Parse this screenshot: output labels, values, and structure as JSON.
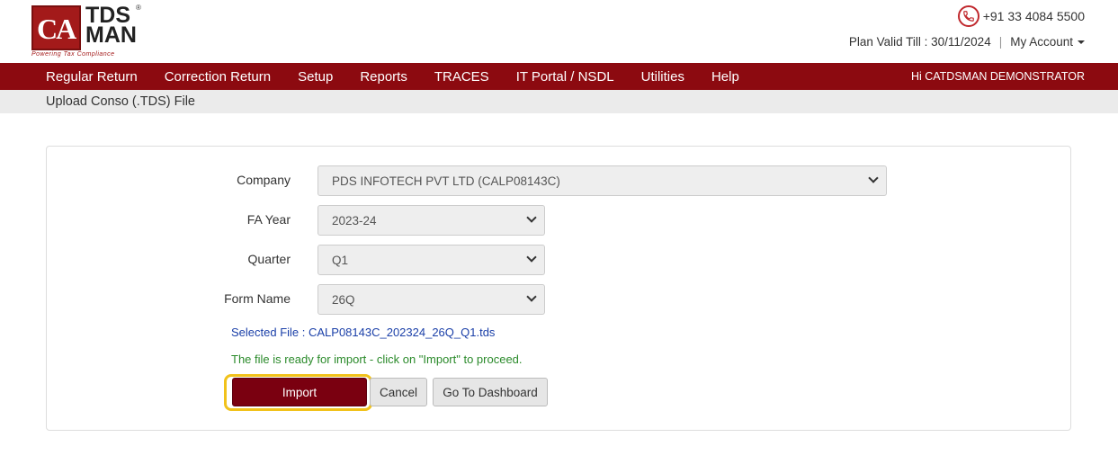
{
  "brand": {
    "logo_mark": "CA",
    "logo_line1": "TDS",
    "logo_line2": "MAN",
    "registered": "®",
    "tagline": "Powering Tax Compliance"
  },
  "header": {
    "phone": "+91 33 4084 5500",
    "plan_label": "Plan Valid Till : 30/11/2024",
    "separator": "|",
    "account_label": "My Account"
  },
  "nav": {
    "items": [
      {
        "label": "Regular Return"
      },
      {
        "label": "Correction Return"
      },
      {
        "label": "Setup"
      },
      {
        "label": "Reports"
      },
      {
        "label": "TRACES"
      },
      {
        "label": "IT Portal / NSDL"
      },
      {
        "label": "Utilities"
      },
      {
        "label": "Help"
      }
    ],
    "greeting": "Hi CATDSMAN DEMONSTRATOR"
  },
  "breadcrumb": {
    "title": "Upload Conso (.TDS) File"
  },
  "form": {
    "company_label": "Company",
    "company_value": "PDS INFOTECH PVT LTD (CALP08143C)",
    "fa_year_label": "FA Year",
    "fa_year_value": "2023-24",
    "quarter_label": "Quarter",
    "quarter_value": "Q1",
    "form_name_label": "Form Name",
    "form_name_value": "26Q",
    "selected_file": "Selected File : CALP08143C_202324_26Q_Q1.tds",
    "ready_message": "The file is ready for import - click on \"Import\" to proceed."
  },
  "buttons": {
    "import": "Import",
    "cancel": "Cancel",
    "dashboard": "Go To Dashboard"
  },
  "colors": {
    "nav_bg": "#8c0a10",
    "import_bg": "#7a0010",
    "highlight": "#f1c21b",
    "selected_file": "#1a3fa8",
    "ready": "#2a8a2a"
  }
}
